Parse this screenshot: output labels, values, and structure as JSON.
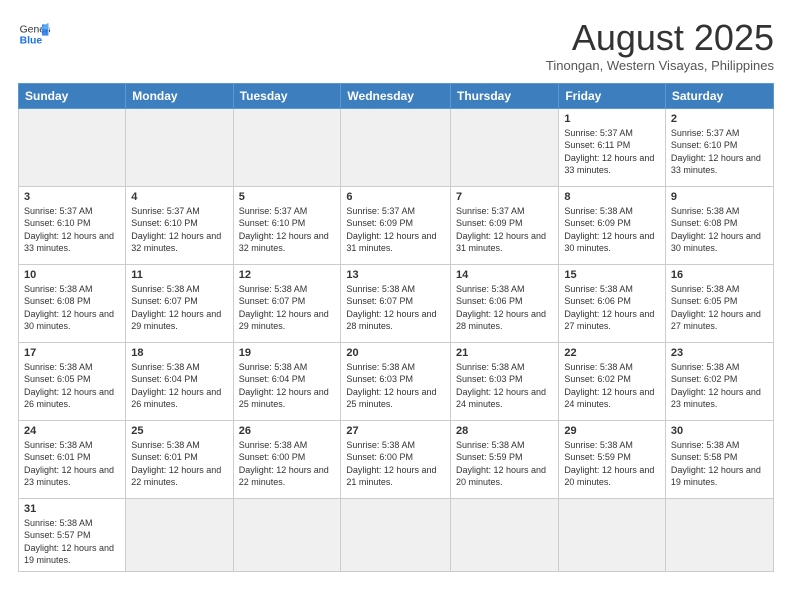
{
  "header": {
    "logo_general": "General",
    "logo_blue": "Blue",
    "month_title": "August 2025",
    "subtitle": "Tinongan, Western Visayas, Philippines"
  },
  "weekdays": [
    "Sunday",
    "Monday",
    "Tuesday",
    "Wednesday",
    "Thursday",
    "Friday",
    "Saturday"
  ],
  "weeks": [
    [
      {
        "day": "",
        "info": ""
      },
      {
        "day": "",
        "info": ""
      },
      {
        "day": "",
        "info": ""
      },
      {
        "day": "",
        "info": ""
      },
      {
        "day": "",
        "info": ""
      },
      {
        "day": "1",
        "info": "Sunrise: 5:37 AM\nSunset: 6:11 PM\nDaylight: 12 hours and 33 minutes."
      },
      {
        "day": "2",
        "info": "Sunrise: 5:37 AM\nSunset: 6:10 PM\nDaylight: 12 hours and 33 minutes."
      }
    ],
    [
      {
        "day": "3",
        "info": "Sunrise: 5:37 AM\nSunset: 6:10 PM\nDaylight: 12 hours and 33 minutes."
      },
      {
        "day": "4",
        "info": "Sunrise: 5:37 AM\nSunset: 6:10 PM\nDaylight: 12 hours and 32 minutes."
      },
      {
        "day": "5",
        "info": "Sunrise: 5:37 AM\nSunset: 6:10 PM\nDaylight: 12 hours and 32 minutes."
      },
      {
        "day": "6",
        "info": "Sunrise: 5:37 AM\nSunset: 6:09 PM\nDaylight: 12 hours and 31 minutes."
      },
      {
        "day": "7",
        "info": "Sunrise: 5:37 AM\nSunset: 6:09 PM\nDaylight: 12 hours and 31 minutes."
      },
      {
        "day": "8",
        "info": "Sunrise: 5:38 AM\nSunset: 6:09 PM\nDaylight: 12 hours and 30 minutes."
      },
      {
        "day": "9",
        "info": "Sunrise: 5:38 AM\nSunset: 6:08 PM\nDaylight: 12 hours and 30 minutes."
      }
    ],
    [
      {
        "day": "10",
        "info": "Sunrise: 5:38 AM\nSunset: 6:08 PM\nDaylight: 12 hours and 30 minutes."
      },
      {
        "day": "11",
        "info": "Sunrise: 5:38 AM\nSunset: 6:07 PM\nDaylight: 12 hours and 29 minutes."
      },
      {
        "day": "12",
        "info": "Sunrise: 5:38 AM\nSunset: 6:07 PM\nDaylight: 12 hours and 29 minutes."
      },
      {
        "day": "13",
        "info": "Sunrise: 5:38 AM\nSunset: 6:07 PM\nDaylight: 12 hours and 28 minutes."
      },
      {
        "day": "14",
        "info": "Sunrise: 5:38 AM\nSunset: 6:06 PM\nDaylight: 12 hours and 28 minutes."
      },
      {
        "day": "15",
        "info": "Sunrise: 5:38 AM\nSunset: 6:06 PM\nDaylight: 12 hours and 27 minutes."
      },
      {
        "day": "16",
        "info": "Sunrise: 5:38 AM\nSunset: 6:05 PM\nDaylight: 12 hours and 27 minutes."
      }
    ],
    [
      {
        "day": "17",
        "info": "Sunrise: 5:38 AM\nSunset: 6:05 PM\nDaylight: 12 hours and 26 minutes."
      },
      {
        "day": "18",
        "info": "Sunrise: 5:38 AM\nSunset: 6:04 PM\nDaylight: 12 hours and 26 minutes."
      },
      {
        "day": "19",
        "info": "Sunrise: 5:38 AM\nSunset: 6:04 PM\nDaylight: 12 hours and 25 minutes."
      },
      {
        "day": "20",
        "info": "Sunrise: 5:38 AM\nSunset: 6:03 PM\nDaylight: 12 hours and 25 minutes."
      },
      {
        "day": "21",
        "info": "Sunrise: 5:38 AM\nSunset: 6:03 PM\nDaylight: 12 hours and 24 minutes."
      },
      {
        "day": "22",
        "info": "Sunrise: 5:38 AM\nSunset: 6:02 PM\nDaylight: 12 hours and 24 minutes."
      },
      {
        "day": "23",
        "info": "Sunrise: 5:38 AM\nSunset: 6:02 PM\nDaylight: 12 hours and 23 minutes."
      }
    ],
    [
      {
        "day": "24",
        "info": "Sunrise: 5:38 AM\nSunset: 6:01 PM\nDaylight: 12 hours and 23 minutes."
      },
      {
        "day": "25",
        "info": "Sunrise: 5:38 AM\nSunset: 6:01 PM\nDaylight: 12 hours and 22 minutes."
      },
      {
        "day": "26",
        "info": "Sunrise: 5:38 AM\nSunset: 6:00 PM\nDaylight: 12 hours and 22 minutes."
      },
      {
        "day": "27",
        "info": "Sunrise: 5:38 AM\nSunset: 6:00 PM\nDaylight: 12 hours and 21 minutes."
      },
      {
        "day": "28",
        "info": "Sunrise: 5:38 AM\nSunset: 5:59 PM\nDaylight: 12 hours and 20 minutes."
      },
      {
        "day": "29",
        "info": "Sunrise: 5:38 AM\nSunset: 5:59 PM\nDaylight: 12 hours and 20 minutes."
      },
      {
        "day": "30",
        "info": "Sunrise: 5:38 AM\nSunset: 5:58 PM\nDaylight: 12 hours and 19 minutes."
      }
    ],
    [
      {
        "day": "31",
        "info": "Sunrise: 5:38 AM\nSunset: 5:57 PM\nDaylight: 12 hours and 19 minutes."
      },
      {
        "day": "",
        "info": ""
      },
      {
        "day": "",
        "info": ""
      },
      {
        "day": "",
        "info": ""
      },
      {
        "day": "",
        "info": ""
      },
      {
        "day": "",
        "info": ""
      },
      {
        "day": "",
        "info": ""
      }
    ]
  ]
}
